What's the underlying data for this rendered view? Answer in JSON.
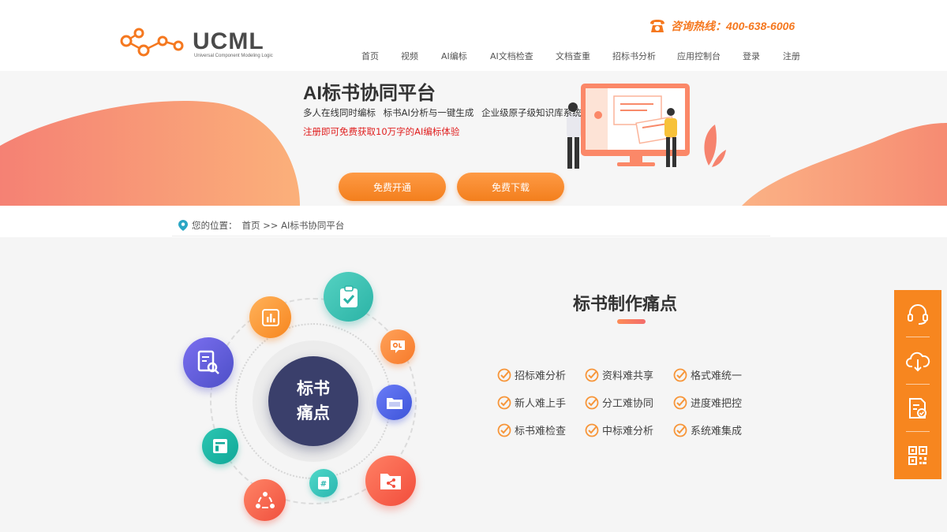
{
  "header": {
    "logo_text": "UCML",
    "logo_subtitle": "Universal Component Modeling Logic",
    "hotline": "咨询热线：400-638-6006",
    "nav": [
      "首页",
      "视频",
      "AI编标",
      "AI文档检查",
      "文档查重",
      "招标书分析",
      "应用控制台",
      "登录",
      "注册"
    ]
  },
  "banner": {
    "title": "AI标书协同平台",
    "features": "多人在线同时编标 标书AI分析与一键生成 企业级原子级知识库系统",
    "promo": "注册即可免费获取10万字的AI编标体验",
    "btn_open": "免费开通",
    "btn_download": "免费下载"
  },
  "breadcrumb": {
    "label": "您的位置：",
    "path": "首页 >> AI标书协同平台"
  },
  "pain": {
    "center_line1": "标书",
    "center_line2": "痛点",
    "title": "标书制作痛点",
    "items": [
      "招标难分析",
      "资料难共享",
      "格式难统一",
      "新人难上手",
      "分工难协同",
      "进度难把控",
      "标书难检查",
      "中标难分析",
      "系统难集成"
    ]
  },
  "orbit_icons": [
    "document-search-icon",
    "bar-chart-icon",
    "clipboard-check-icon",
    "ol-badge-icon",
    "folder-icon",
    "layout-icon",
    "share-icon",
    "hash-icon",
    "folder-share-icon"
  ],
  "side_toolbar": [
    "headset-icon",
    "cloud-download-icon",
    "document-check-icon",
    "qr-code-icon"
  ],
  "colors": {
    "accent": "#f5781f",
    "promo_red": "#e02020",
    "center_navy": "#3a3f6b"
  }
}
